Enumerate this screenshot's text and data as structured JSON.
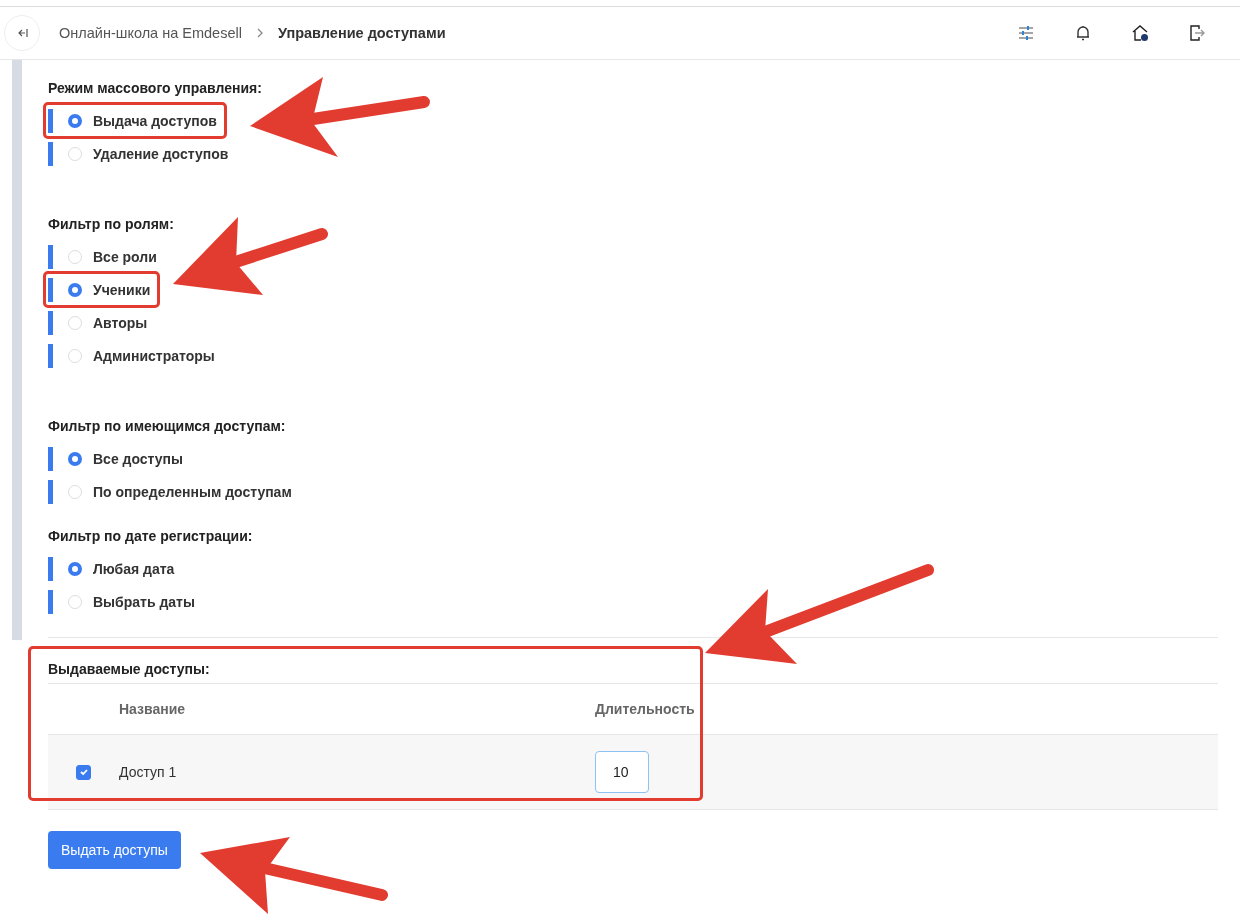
{
  "header": {
    "breadcrumbs": [
      {
        "label": "Онлайн-школа на Emdesell",
        "current": false
      },
      {
        "label": "Управление доступами",
        "current": true
      }
    ]
  },
  "groups": [
    {
      "title": "Режим массового управления:",
      "options": [
        {
          "label": "Выдача доступов",
          "selected": true,
          "highlighted": true
        },
        {
          "label": "Удаление доступов",
          "selected": false,
          "highlighted": false
        }
      ]
    },
    {
      "title": "Фильтр по ролям:",
      "options": [
        {
          "label": "Все роли",
          "selected": false,
          "highlighted": false
        },
        {
          "label": "Ученики",
          "selected": true,
          "highlighted": true
        },
        {
          "label": "Авторы",
          "selected": false,
          "highlighted": false
        },
        {
          "label": "Администраторы",
          "selected": false,
          "highlighted": false
        }
      ]
    },
    {
      "title": "Фильтр по имеющимся доступам:",
      "options": [
        {
          "label": "Все доступы",
          "selected": true,
          "highlighted": false
        },
        {
          "label": "По определенным доступам",
          "selected": false,
          "highlighted": false
        }
      ]
    },
    {
      "title": "Фильтр по дате регистрации:",
      "options": [
        {
          "label": "Любая дата",
          "selected": true,
          "highlighted": false
        },
        {
          "label": "Выбрать даты",
          "selected": false,
          "highlighted": false
        }
      ]
    }
  ],
  "access_section": {
    "title": "Выдаваемые доступы:",
    "highlighted": true,
    "columns": [
      "Название",
      "Длительность"
    ],
    "rows": [
      {
        "checked": true,
        "name": "Доступ 1",
        "duration": "10"
      }
    ]
  },
  "submit_button": "Выдать доступы"
}
